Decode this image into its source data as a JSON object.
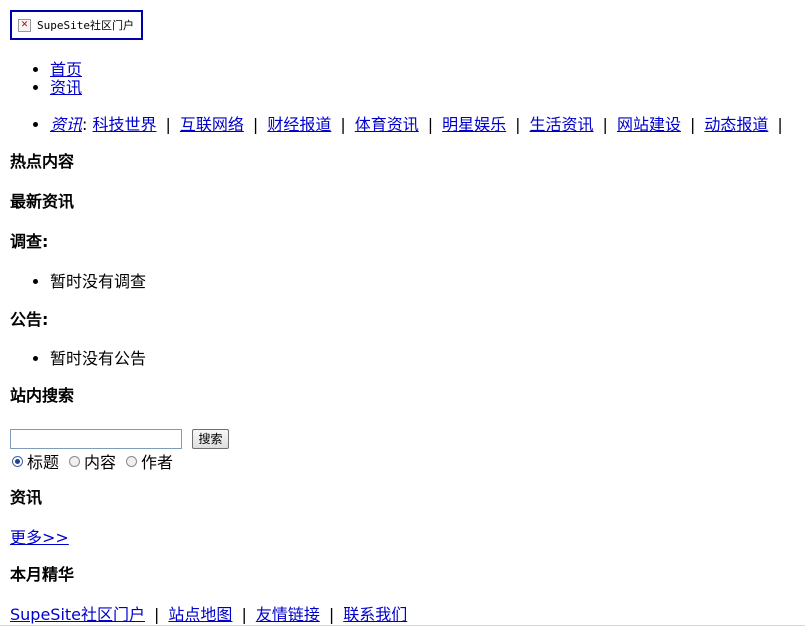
{
  "logo": {
    "alt_text": "SupeSite社区门户"
  },
  "main_nav": [
    "首页",
    "资讯"
  ],
  "channel_nav": {
    "label": "资讯",
    "items": [
      "科技世界",
      "互联网络",
      "财经报道",
      "体育资讯",
      "明星娱乐",
      "生活资讯",
      "网站建设",
      "动态报道"
    ]
  },
  "sections": {
    "hot": "热点内容",
    "latest": "最新资讯",
    "poll_title": "调查:",
    "poll_empty": "暂时没有调查",
    "notice_title": "公告:",
    "notice_empty": "暂时没有公告",
    "search_title": "站内搜索",
    "news_title": "资讯",
    "more": "更多>>",
    "best_month": "本月精华"
  },
  "search": {
    "input_value": "",
    "button_label": "搜索",
    "options": [
      {
        "label": "标题",
        "checked": true
      },
      {
        "label": "内容",
        "checked": false
      },
      {
        "label": "作者",
        "checked": false
      }
    ]
  },
  "footer": {
    "links": [
      "SupeSite社区门户",
      "站点地图",
      "友情链接",
      "联系我们"
    ],
    "separator": "|"
  }
}
